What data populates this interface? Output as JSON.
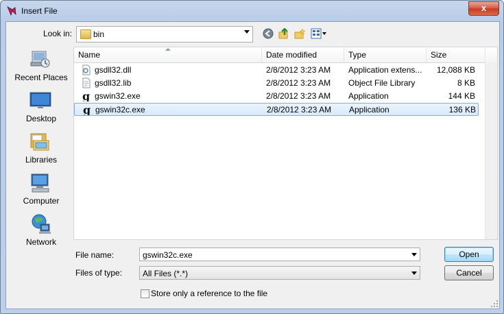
{
  "window": {
    "title": "Insert File",
    "close_label": "x"
  },
  "toolbar": {
    "look_in_label": "Look in:",
    "look_in_value": "bin",
    "icons": [
      "back-icon",
      "up-folder-icon",
      "new-folder-icon",
      "view-menu-icon"
    ]
  },
  "places": [
    {
      "label": "Recent Places",
      "icon": "recent-places-icon"
    },
    {
      "label": "Desktop",
      "icon": "desktop-icon"
    },
    {
      "label": "Libraries",
      "icon": "libraries-icon"
    },
    {
      "label": "Computer",
      "icon": "computer-icon"
    },
    {
      "label": "Network",
      "icon": "network-icon"
    }
  ],
  "columns": [
    "Name",
    "Date modified",
    "Type",
    "Size"
  ],
  "files": [
    {
      "name": "gsdll32.dll",
      "date": "2/8/2012 3:23 AM",
      "type": "Application extens...",
      "size": "12,088 KB",
      "icon": "dll-icon"
    },
    {
      "name": "gsdll32.lib",
      "date": "2/8/2012 3:23 AM",
      "type": "Object File Library",
      "size": "8 KB",
      "icon": "lib-file-icon"
    },
    {
      "name": "gswin32.exe",
      "date": "2/8/2012 3:23 AM",
      "type": "Application",
      "size": "144 KB",
      "icon": "ghostscript-icon"
    },
    {
      "name": "gswin32c.exe",
      "date": "2/8/2012 3:23 AM",
      "type": "Application",
      "size": "136 KB",
      "icon": "ghostscript-icon",
      "selected": true
    }
  ],
  "form": {
    "file_name_label": "File name:",
    "file_name_value": "gswin32c.exe",
    "file_type_label": "Files of type:",
    "file_type_value": "All Files (*.*)",
    "open_label": "Open",
    "cancel_label": "Cancel",
    "reference_checkbox_label": "Store only a reference to the file",
    "reference_checked": false
  },
  "colors": {
    "selection_bg": "#d9eafc",
    "selection_border": "#84acdd",
    "frame": "#bcd0ea"
  }
}
